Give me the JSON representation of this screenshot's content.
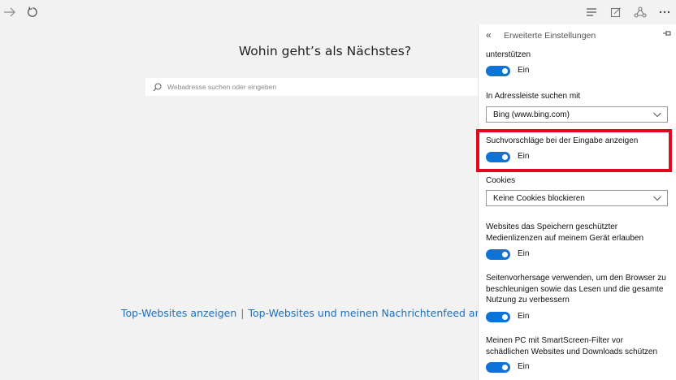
{
  "browser": {
    "forward_icon": "arrow-right-icon",
    "refresh_icon": "refresh-icon",
    "toolbar_icons": [
      "hub-icon",
      "web-note-icon",
      "share-icon",
      "more-icon"
    ]
  },
  "newtab": {
    "headline": "Wohin geht’s als Nächstes?",
    "search_placeholder": "Webadresse suchen oder eingeben",
    "links": [
      "Top-Websites anzeigen",
      "Top-Websites und meinen Nachrichtenfeed anzeigen"
    ],
    "separator": "|"
  },
  "panel": {
    "back_icon": "«",
    "title": "Erweiterte Einstellungen",
    "settings": {
      "support_tail": "unterstützen",
      "support_toggle": "Ein",
      "addressbar_label": "In Adressleiste suchen mit",
      "addressbar_value": "Bing (www.bing.com)",
      "suggestions_label": "Suchvorschläge bei der Eingabe anzeigen",
      "suggestions_toggle": "Ein",
      "cookies_label": "Cookies",
      "cookies_value": "Keine Cookies blockieren",
      "licenses_label": "Websites das Speichern geschützter Medienlizenzen auf meinem Gerät erlauben",
      "licenses_toggle": "Ein",
      "prediction_label": "Seitenvorhersage verwenden, um den Browser zu beschleunigen sowie das Lesen und die gesamte Nutzung zu verbessern",
      "prediction_toggle": "Ein",
      "smartscreen_label": "Meinen PC mit SmartScreen-Filter vor schädlichen Websites und Downloads schützen",
      "smartscreen_toggle": "Ein"
    }
  },
  "colors": {
    "accent": "#0e72d6",
    "link": "#1a70c0",
    "highlight": "#e0071e"
  }
}
